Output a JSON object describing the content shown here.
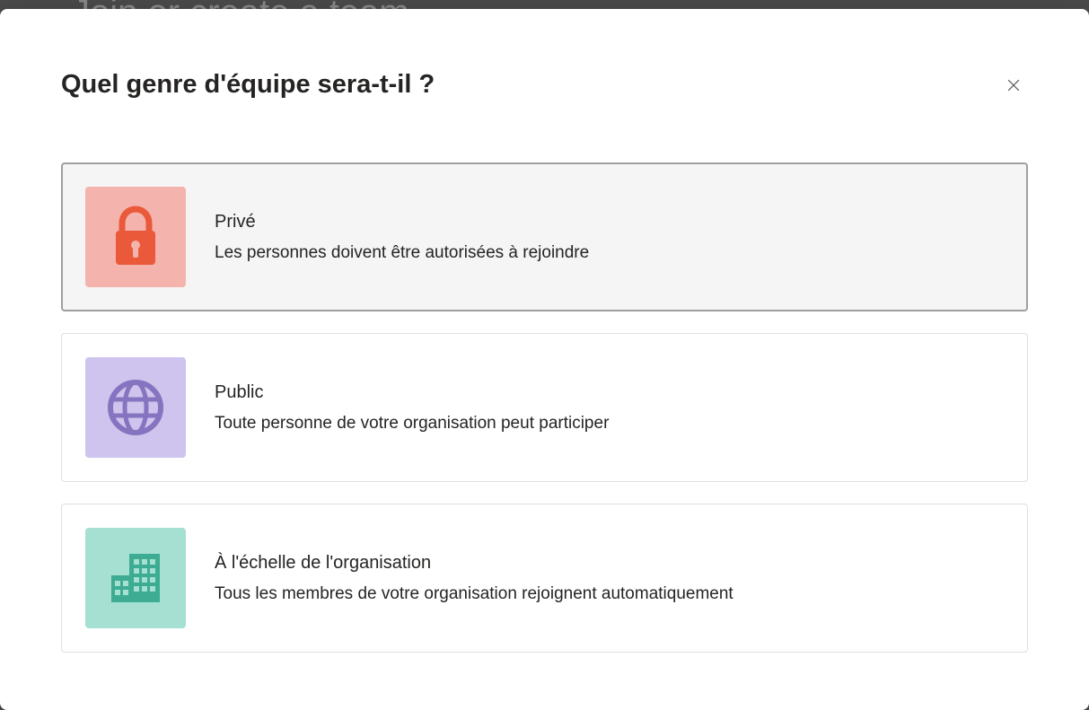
{
  "backdrop": {
    "text": "Join or create a team"
  },
  "modal": {
    "title": "Quel genre d'équipe sera-t-il ?",
    "options": [
      {
        "icon": "lock-icon",
        "title": "Privé",
        "desc": "Les personnes doivent être autorisées à rejoindre",
        "selected": true
      },
      {
        "icon": "globe-icon",
        "title": "Public",
        "desc": "Toute personne de votre organisation peut participer",
        "selected": false
      },
      {
        "icon": "building-icon",
        "title": "À l'échelle de l'organisation",
        "desc": "Tous les membres de votre organisation rejoignent automatiquement",
        "selected": false
      }
    ]
  }
}
